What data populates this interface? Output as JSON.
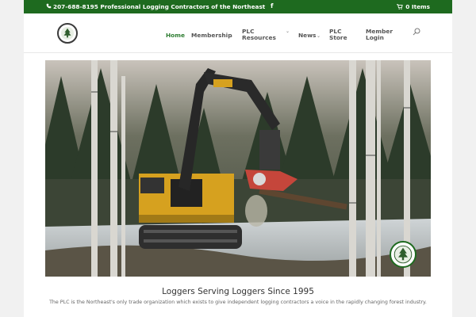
{
  "topbar": {
    "phone": "207-688-8195 Professional Logging Contractors of the Northeast",
    "facebook": "f",
    "cart": "0 Items",
    "phone_icon": "phone-icon",
    "cart_icon": "cart-icon",
    "facebook_icon": "facebook-icon"
  },
  "header": {
    "logo_icon": "plc-logo",
    "nav": [
      {
        "label": "Home",
        "active": true
      },
      {
        "label": "Membership",
        "has_dropdown": true
      },
      {
        "label": "PLC Resources",
        "has_dropdown": true
      },
      {
        "label": "News",
        "has_dropdown": true
      },
      {
        "label": "PLC Store",
        "has_dropdown": false
      },
      {
        "label": "Member Login",
        "has_dropdown": false
      }
    ],
    "search_icon": "search-icon"
  },
  "hero": {
    "image": "forest-harvester-photo",
    "badge_icon": "plc-seal-logo"
  },
  "content": {
    "tagline": "Loggers Serving Loggers Since 1995",
    "description": "The PLC is the Northeast's only trade organization which exists to give independent logging contractors a voice in the rapidly changing forest industry."
  },
  "colors": {
    "brand_green": "#1e6a1f",
    "active_nav": "#2e7d32",
    "background": "#f1f1f1"
  }
}
